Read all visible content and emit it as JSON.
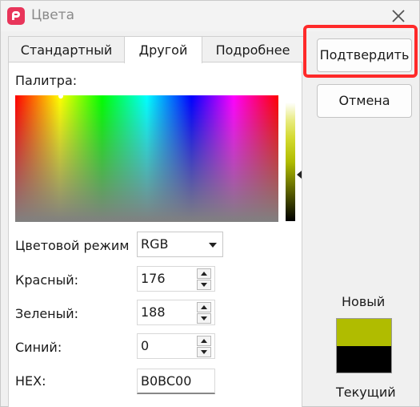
{
  "window": {
    "title": "Цвета",
    "close_glyph": "✕"
  },
  "tabs": [
    {
      "label": "Стандартный",
      "active": false
    },
    {
      "label": "Другой",
      "active": true
    },
    {
      "label": "Подробнее",
      "active": false
    }
  ],
  "palette": {
    "label": "Палитра:"
  },
  "color_mode": {
    "label": "Цветовой режим",
    "selected": "RGB"
  },
  "fields": {
    "red": {
      "label": "Красный:",
      "value": "176"
    },
    "green": {
      "label": "Зеленый:",
      "value": "188"
    },
    "blue": {
      "label": "Синий:",
      "value": "0"
    },
    "hex": {
      "label": "HEX:",
      "value": "B0BC00"
    }
  },
  "buttons": {
    "confirm": "Подтвердить",
    "cancel": "Отмена"
  },
  "preview": {
    "new_label": "Новый",
    "current_label": "Текущий",
    "new_color": "#B0BC00",
    "current_color": "#000000"
  },
  "colors": {
    "highlight": "#ff2a2a",
    "app_icon": "#e8355a"
  }
}
